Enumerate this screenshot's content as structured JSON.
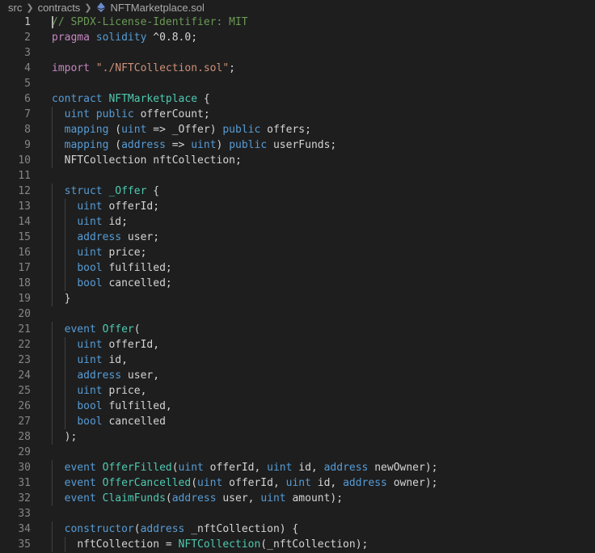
{
  "breadcrumb": {
    "items": [
      "src",
      "contracts",
      "NFTMarketplace.sol"
    ],
    "file_icon": "ethereum-icon",
    "icon_color": "#6a8ccf"
  },
  "editor": {
    "active_line": 1,
    "colors": {
      "background": "#1e1e1e",
      "keyword": "#569cd6",
      "comment": "#6a9955",
      "string": "#ce9178",
      "type": "#4ec9b0",
      "pragma_keyword": "#c586c0",
      "plain": "#d4d4d4",
      "line_number": "#858585"
    },
    "lines": [
      {
        "n": "1",
        "indent": 0,
        "t": [
          [
            "c",
            "// SPDX-License-Identifier: MIT"
          ]
        ]
      },
      {
        "n": "2",
        "indent": 0,
        "t": [
          [
            "pk",
            "pragma"
          ],
          [
            "p",
            " "
          ],
          [
            "k",
            "solidity"
          ],
          [
            "p",
            " ^0.8.0;"
          ]
        ]
      },
      {
        "n": "3",
        "indent": 0,
        "t": []
      },
      {
        "n": "4",
        "indent": 0,
        "t": [
          [
            "pk",
            "import"
          ],
          [
            "p",
            " "
          ],
          [
            "s",
            "\"./NFTCollection.sol\""
          ],
          [
            "p",
            ";"
          ]
        ]
      },
      {
        "n": "5",
        "indent": 0,
        "t": []
      },
      {
        "n": "6",
        "indent": 0,
        "t": [
          [
            "k",
            "contract"
          ],
          [
            "p",
            " "
          ],
          [
            "e",
            "NFTMarketplace"
          ],
          [
            "p",
            " {"
          ]
        ]
      },
      {
        "n": "7",
        "indent": 1,
        "t": [
          [
            "k",
            "uint"
          ],
          [
            "p",
            " "
          ],
          [
            "k",
            "public"
          ],
          [
            "p",
            " offerCount;"
          ]
        ]
      },
      {
        "n": "8",
        "indent": 1,
        "t": [
          [
            "k",
            "mapping"
          ],
          [
            "p",
            " ("
          ],
          [
            "k",
            "uint"
          ],
          [
            "p",
            " => _Offer) "
          ],
          [
            "k",
            "public"
          ],
          [
            "p",
            " offers;"
          ]
        ]
      },
      {
        "n": "9",
        "indent": 1,
        "t": [
          [
            "k",
            "mapping"
          ],
          [
            "p",
            " ("
          ],
          [
            "k",
            "address"
          ],
          [
            "p",
            " => "
          ],
          [
            "k",
            "uint"
          ],
          [
            "p",
            ") "
          ],
          [
            "k",
            "public"
          ],
          [
            "p",
            " userFunds;"
          ]
        ]
      },
      {
        "n": "10",
        "indent": 1,
        "t": [
          [
            "p",
            "NFTCollection nftCollection;"
          ]
        ]
      },
      {
        "n": "11",
        "indent": 0,
        "t": []
      },
      {
        "n": "12",
        "indent": 1,
        "t": [
          [
            "k",
            "struct"
          ],
          [
            "p",
            " "
          ],
          [
            "e",
            "_Offer"
          ],
          [
            "p",
            " {"
          ]
        ]
      },
      {
        "n": "13",
        "indent": 2,
        "t": [
          [
            "k",
            "uint"
          ],
          [
            "p",
            " offerId;"
          ]
        ]
      },
      {
        "n": "14",
        "indent": 2,
        "t": [
          [
            "k",
            "uint"
          ],
          [
            "p",
            " id;"
          ]
        ]
      },
      {
        "n": "15",
        "indent": 2,
        "t": [
          [
            "k",
            "address"
          ],
          [
            "p",
            " user;"
          ]
        ]
      },
      {
        "n": "16",
        "indent": 2,
        "t": [
          [
            "k",
            "uint"
          ],
          [
            "p",
            " price;"
          ]
        ]
      },
      {
        "n": "17",
        "indent": 2,
        "t": [
          [
            "k",
            "bool"
          ],
          [
            "p",
            " fulfilled;"
          ]
        ]
      },
      {
        "n": "18",
        "indent": 2,
        "t": [
          [
            "k",
            "bool"
          ],
          [
            "p",
            " cancelled;"
          ]
        ]
      },
      {
        "n": "19",
        "indent": 1,
        "t": [
          [
            "p",
            "}"
          ]
        ]
      },
      {
        "n": "20",
        "indent": 0,
        "t": []
      },
      {
        "n": "21",
        "indent": 1,
        "t": [
          [
            "k",
            "event"
          ],
          [
            "p",
            " "
          ],
          [
            "e",
            "Offer"
          ],
          [
            "p",
            "("
          ]
        ]
      },
      {
        "n": "22",
        "indent": 2,
        "t": [
          [
            "k",
            "uint"
          ],
          [
            "p",
            " offerId,"
          ]
        ]
      },
      {
        "n": "23",
        "indent": 2,
        "t": [
          [
            "k",
            "uint"
          ],
          [
            "p",
            " id,"
          ]
        ]
      },
      {
        "n": "24",
        "indent": 2,
        "t": [
          [
            "k",
            "address"
          ],
          [
            "p",
            " user,"
          ]
        ]
      },
      {
        "n": "25",
        "indent": 2,
        "t": [
          [
            "k",
            "uint"
          ],
          [
            "p",
            " price,"
          ]
        ]
      },
      {
        "n": "26",
        "indent": 2,
        "t": [
          [
            "k",
            "bool"
          ],
          [
            "p",
            " fulfilled,"
          ]
        ]
      },
      {
        "n": "27",
        "indent": 2,
        "t": [
          [
            "k",
            "bool"
          ],
          [
            "p",
            " cancelled"
          ]
        ]
      },
      {
        "n": "28",
        "indent": 1,
        "t": [
          [
            "p",
            ");"
          ]
        ]
      },
      {
        "n": "29",
        "indent": 0,
        "t": []
      },
      {
        "n": "30",
        "indent": 1,
        "t": [
          [
            "k",
            "event"
          ],
          [
            "p",
            " "
          ],
          [
            "e",
            "OfferFilled"
          ],
          [
            "p",
            "("
          ],
          [
            "k",
            "uint"
          ],
          [
            "p",
            " offerId, "
          ],
          [
            "k",
            "uint"
          ],
          [
            "p",
            " id, "
          ],
          [
            "k",
            "address"
          ],
          [
            "p",
            " newOwner);"
          ]
        ]
      },
      {
        "n": "31",
        "indent": 1,
        "t": [
          [
            "k",
            "event"
          ],
          [
            "p",
            " "
          ],
          [
            "e",
            "OfferCancelled"
          ],
          [
            "p",
            "("
          ],
          [
            "k",
            "uint"
          ],
          [
            "p",
            " offerId, "
          ],
          [
            "k",
            "uint"
          ],
          [
            "p",
            " id, "
          ],
          [
            "k",
            "address"
          ],
          [
            "p",
            " owner);"
          ]
        ]
      },
      {
        "n": "32",
        "indent": 1,
        "t": [
          [
            "k",
            "event"
          ],
          [
            "p",
            " "
          ],
          [
            "e",
            "ClaimFunds"
          ],
          [
            "p",
            "("
          ],
          [
            "k",
            "address"
          ],
          [
            "p",
            " user, "
          ],
          [
            "k",
            "uint"
          ],
          [
            "p",
            " amount);"
          ]
        ]
      },
      {
        "n": "33",
        "indent": 0,
        "t": []
      },
      {
        "n": "34",
        "indent": 1,
        "t": [
          [
            "k",
            "constructor"
          ],
          [
            "p",
            "("
          ],
          [
            "k",
            "address"
          ],
          [
            "p",
            " _nftCollection) {"
          ]
        ]
      },
      {
        "n": "35",
        "indent": 2,
        "t": [
          [
            "p",
            "nftCollection = "
          ],
          [
            "e",
            "NFTCollection"
          ],
          [
            "p",
            "(_nftCollection);"
          ]
        ]
      }
    ]
  }
}
